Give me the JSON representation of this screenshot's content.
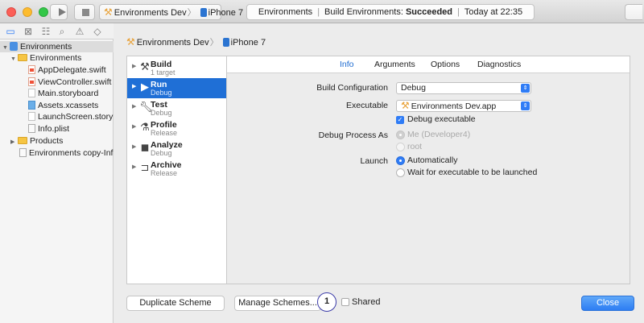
{
  "toolbar": {
    "scheme_name": "Environments Dev",
    "destination": "iPhone 7",
    "status_project": "Environments",
    "status_action": "Build Environments:",
    "status_result": "Succeeded",
    "status_time": "Today at 22:35"
  },
  "navigator": {
    "tab_icons": [
      "folder-icon",
      "source-control-icon",
      "symbol-icon",
      "search-icon",
      "warning-icon",
      "test-icon"
    ],
    "items": [
      {
        "label": "Environments",
        "kind": "project"
      },
      {
        "label": "Environments",
        "kind": "folder"
      },
      {
        "label": "AppDelegate.swift",
        "kind": "swift"
      },
      {
        "label": "ViewController.swift",
        "kind": "swift"
      },
      {
        "label": "Main.storyboard",
        "kind": "storyboard"
      },
      {
        "label": "Assets.xcassets",
        "kind": "assets"
      },
      {
        "label": "LaunchScreen.storyboard",
        "kind": "storyboard"
      },
      {
        "label": "Info.plist",
        "kind": "plist"
      },
      {
        "label": "Products",
        "kind": "folder"
      },
      {
        "label": "Environments copy-Info.plist",
        "kind": "plist"
      }
    ]
  },
  "sheet": {
    "scheme_name": "Environments Dev",
    "destination": "iPhone 7",
    "actions": [
      {
        "title": "Build",
        "subtitle": "1 target",
        "icon": "hammer-icon"
      },
      {
        "title": "Run",
        "subtitle": "Debug",
        "icon": "play-icon"
      },
      {
        "title": "Test",
        "subtitle": "Debug",
        "icon": "wrench-icon"
      },
      {
        "title": "Profile",
        "subtitle": "Release",
        "icon": "instruments-icon"
      },
      {
        "title": "Analyze",
        "subtitle": "Debug",
        "icon": "analyze-icon"
      },
      {
        "title": "Archive",
        "subtitle": "Release",
        "icon": "archive-icon"
      }
    ],
    "selected_action": "Run",
    "tabs": [
      "Info",
      "Arguments",
      "Options",
      "Diagnostics"
    ],
    "active_tab": "Info",
    "fields": {
      "build_config_label": "Build Configuration",
      "build_config_value": "Debug",
      "executable_label": "Executable",
      "executable_value": "Environments Dev.app",
      "debug_exec_label": "Debug executable",
      "debug_process_label": "Debug Process As",
      "debug_process_me": "Me (Developer4)",
      "debug_process_root": "root",
      "launch_label": "Launch",
      "launch_auto": "Automatically",
      "launch_wait": "Wait for executable to be launched"
    },
    "buttons": {
      "duplicate": "Duplicate Scheme",
      "manage": "Manage Schemes...",
      "shared": "Shared",
      "close": "Close"
    },
    "callout_number": "1"
  }
}
